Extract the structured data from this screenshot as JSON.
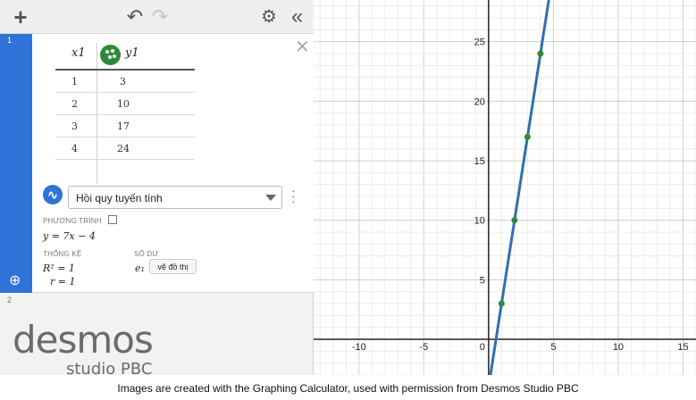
{
  "toolbar": {
    "add_icon": "plus-icon",
    "undo_icon": "undo-icon",
    "redo_icon": "redo-icon",
    "settings_icon": "gear-icon",
    "collapse_icon": "double-chevron-left-icon"
  },
  "expressions": [
    {
      "number": "1",
      "color": "#2d8a3a",
      "table": {
        "headers": [
          "x1",
          "y1"
        ],
        "rows": [
          [
            "1",
            "3"
          ],
          [
            "2",
            "10"
          ],
          [
            "3",
            "17"
          ],
          [
            "4",
            "24"
          ]
        ]
      },
      "regression": {
        "type_label": "Hồi quy tuyến tính",
        "equation_label": "PHƯƠNG TRÌNH",
        "equation": "y = 7x − 4",
        "stats_label": "THỐNG KÊ",
        "r_squared": "R² = 1",
        "r": "r = 1",
        "residual_label": "SỐ DƯ",
        "residual_var": "e₁",
        "plot_button": "vẽ đồ thị"
      }
    },
    {
      "number": "2"
    }
  ],
  "logo": {
    "main": "desmos",
    "sub": "studio PBC"
  },
  "graph": {
    "x_ticks": [
      "-10",
      "-5",
      "0",
      "5",
      "10",
      "15"
    ],
    "y_ticks": [
      "5",
      "10",
      "15",
      "20",
      "25"
    ],
    "x_range": [
      -13.5,
      16
    ],
    "y_range": [
      -3,
      28.5
    ],
    "line": {
      "slope": 7,
      "intercept": -4,
      "color": "#2d70b3"
    },
    "points": [
      [
        1,
        3
      ],
      [
        2,
        10
      ],
      [
        3,
        17
      ],
      [
        4,
        24
      ]
    ],
    "point_color": "#2d8a3a"
  },
  "caption": "Images are created with the Graphing Calculator, used with permission from Desmos Studio PBC"
}
